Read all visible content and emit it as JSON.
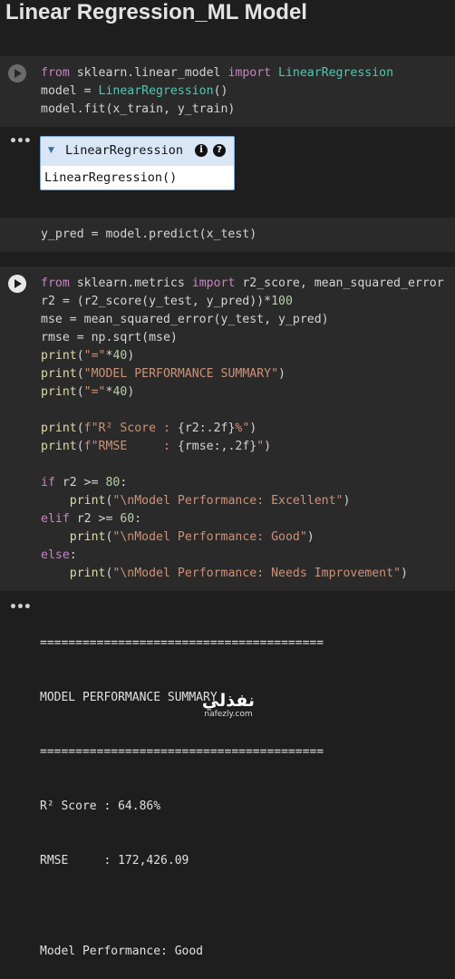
{
  "page": {
    "title": "Linear Regression_ML Model"
  },
  "cells": {
    "c1": {
      "lines": [
        [
          [
            "kw",
            "from"
          ],
          [
            "t",
            " sklearn.linear_model "
          ],
          [
            "kw",
            "import"
          ],
          [
            "cls",
            " LinearRegression"
          ]
        ],
        [
          [
            "t",
            "model = "
          ],
          [
            "cls",
            "LinearRegression"
          ],
          [
            "t",
            "()"
          ]
        ],
        [
          [
            "t",
            "model.fit(x_train, y_train)"
          ]
        ]
      ]
    },
    "c1_output": {
      "estimator_name": "LinearRegression",
      "info_icon": "i",
      "help_icon": "?",
      "estimator_repr": "LinearRegression()"
    },
    "c2": {
      "lines": [
        [
          [
            "t",
            "y_pred = model.predict(x_test)"
          ]
        ]
      ]
    },
    "c3": {
      "lines": [
        [
          [
            "kw",
            "from"
          ],
          [
            "t",
            " sklearn.metrics "
          ],
          [
            "kw",
            "import"
          ],
          [
            "t",
            " r2_score, mean_squared_error"
          ]
        ],
        [
          [
            "t",
            "r2 = (r2_score(y_test, y_pred))*"
          ],
          [
            "num",
            "100"
          ]
        ],
        [
          [
            "t",
            "mse = mean_squared_error(y_test, y_pred)"
          ]
        ],
        [
          [
            "t",
            "rmse = np.sqrt(mse)"
          ]
        ],
        [
          [
            "fn",
            "print"
          ],
          [
            "t",
            "("
          ],
          [
            "str",
            "\"=\""
          ],
          [
            "t",
            "*"
          ],
          [
            "num",
            "40"
          ],
          [
            "t",
            ")"
          ]
        ],
        [
          [
            "fn",
            "print"
          ],
          [
            "t",
            "("
          ],
          [
            "str",
            "\"MODEL PERFORMANCE SUMMARY\""
          ],
          [
            "t",
            ")"
          ]
        ],
        [
          [
            "fn",
            "print"
          ],
          [
            "t",
            "("
          ],
          [
            "str",
            "\"=\""
          ],
          [
            "t",
            "*"
          ],
          [
            "num",
            "40"
          ],
          [
            "t",
            ")"
          ]
        ],
        [
          [
            "t",
            ""
          ]
        ],
        [
          [
            "fn",
            "print"
          ],
          [
            "t",
            "("
          ],
          [
            "str",
            "f\"R² Score : "
          ],
          [
            "t",
            "{r2:.2f}"
          ],
          [
            "str",
            "%\""
          ],
          [
            "t",
            ")"
          ]
        ],
        [
          [
            "fn",
            "print"
          ],
          [
            "t",
            "("
          ],
          [
            "str",
            "f\"RMSE     : "
          ],
          [
            "t",
            "{rmse:,.2f}"
          ],
          [
            "str",
            "\""
          ],
          [
            "t",
            ")"
          ]
        ],
        [
          [
            "t",
            ""
          ]
        ],
        [
          [
            "kw",
            "if"
          ],
          [
            "t",
            " r2 >= "
          ],
          [
            "num",
            "80"
          ],
          [
            "t",
            ":"
          ]
        ],
        [
          [
            "t",
            "    "
          ],
          [
            "fn",
            "print"
          ],
          [
            "t",
            "("
          ],
          [
            "str",
            "\"\\nModel Performance: Excellent\""
          ],
          [
            "t",
            ")"
          ]
        ],
        [
          [
            "kw",
            "elif"
          ],
          [
            "t",
            " r2 >= "
          ],
          [
            "num",
            "60"
          ],
          [
            "t",
            ":"
          ]
        ],
        [
          [
            "t",
            "    "
          ],
          [
            "fn",
            "print"
          ],
          [
            "t",
            "("
          ],
          [
            "str",
            "\"\\nModel Performance: Good\""
          ],
          [
            "t",
            ")"
          ]
        ],
        [
          [
            "kw",
            "else"
          ],
          [
            "t",
            ":"
          ]
        ],
        [
          [
            "t",
            "    "
          ],
          [
            "fn",
            "print"
          ],
          [
            "t",
            "("
          ],
          [
            "str",
            "\"\\nModel Performance: Needs Improvement\""
          ],
          [
            "t",
            ")"
          ]
        ]
      ]
    },
    "c3_output": {
      "lines": [
        "========================================",
        "MODEL PERFORMANCE SUMMARY",
        "========================================",
        "R² Score : 64.86%",
        "RMSE     : 172,426.09",
        "",
        "Model Performance: Good"
      ]
    }
  },
  "watermark": {
    "arabic": "نفذلي",
    "url": "nafezly.com"
  },
  "icons": {
    "run": "play-icon",
    "output_menu": "more-horizontal-icon",
    "expand": "triangle-down-icon"
  },
  "colors": {
    "keyword": "#c586c0",
    "string": "#ce9178",
    "number": "#b5cea8",
    "function": "#dcdcaa",
    "class": "#4ec9b0"
  }
}
